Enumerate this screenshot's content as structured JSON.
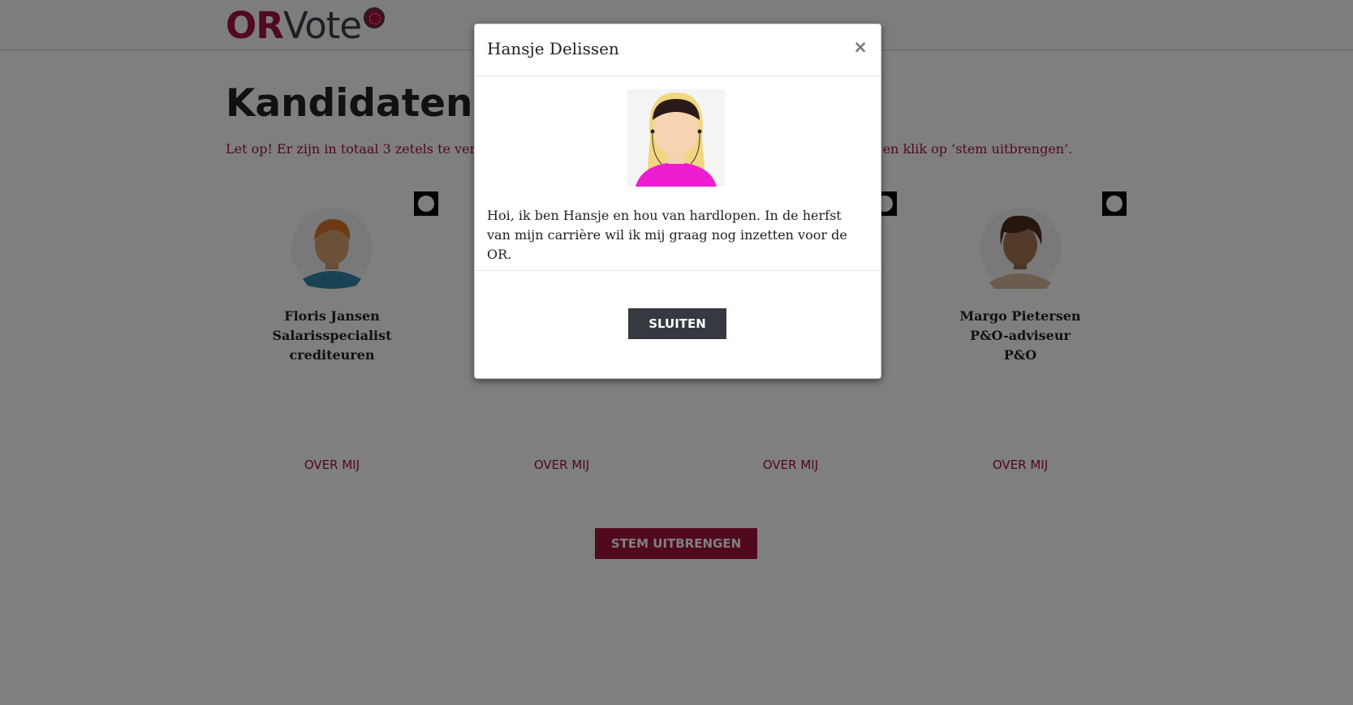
{
  "app": {
    "logo_primary": "OR",
    "logo_secondary": "Vote"
  },
  "page": {
    "title": "Kandidaten",
    "notice": "Let op! Er zijn in totaal 3 zetels te verdelen. Kies maximaal 3 kandidaten. Selecteer uw kandidaten en klik op ‘stem uitbrengen’."
  },
  "candidates": [
    {
      "name": "Floris Jansen",
      "role": "Salarisspecialist",
      "dept": "crediteuren",
      "link": "OVER MIJ"
    },
    {
      "name": "Hansje Delissen",
      "role": "",
      "dept": "",
      "link": "OVER MIJ"
    },
    {
      "name": "",
      "role": "",
      "dept": "",
      "link": "OVER MIJ"
    },
    {
      "name": "Margo Pietersen",
      "role": "P&O-adviseur",
      "dept": "P&O",
      "link": "OVER MIJ"
    }
  ],
  "actions": {
    "submit_label": "STEM UITBRENGEN"
  },
  "modal": {
    "title": "Hansje Delissen",
    "close_symbol": "×",
    "bio": "Hoi, ik ben Hansje en hou van hardlopen. In de herfst van mijn carrière wil ik mij graag nog inzetten voor de OR.",
    "close_button_label": "SLUITEN"
  },
  "icons": {
    "logo_mark": "ballot-stamp-icon",
    "checkbox": "circle-check-icon"
  },
  "colors": {
    "brand": "#a3123a",
    "dark": "#343a40",
    "overlay": "rgba(0,0,0,0.5)"
  }
}
